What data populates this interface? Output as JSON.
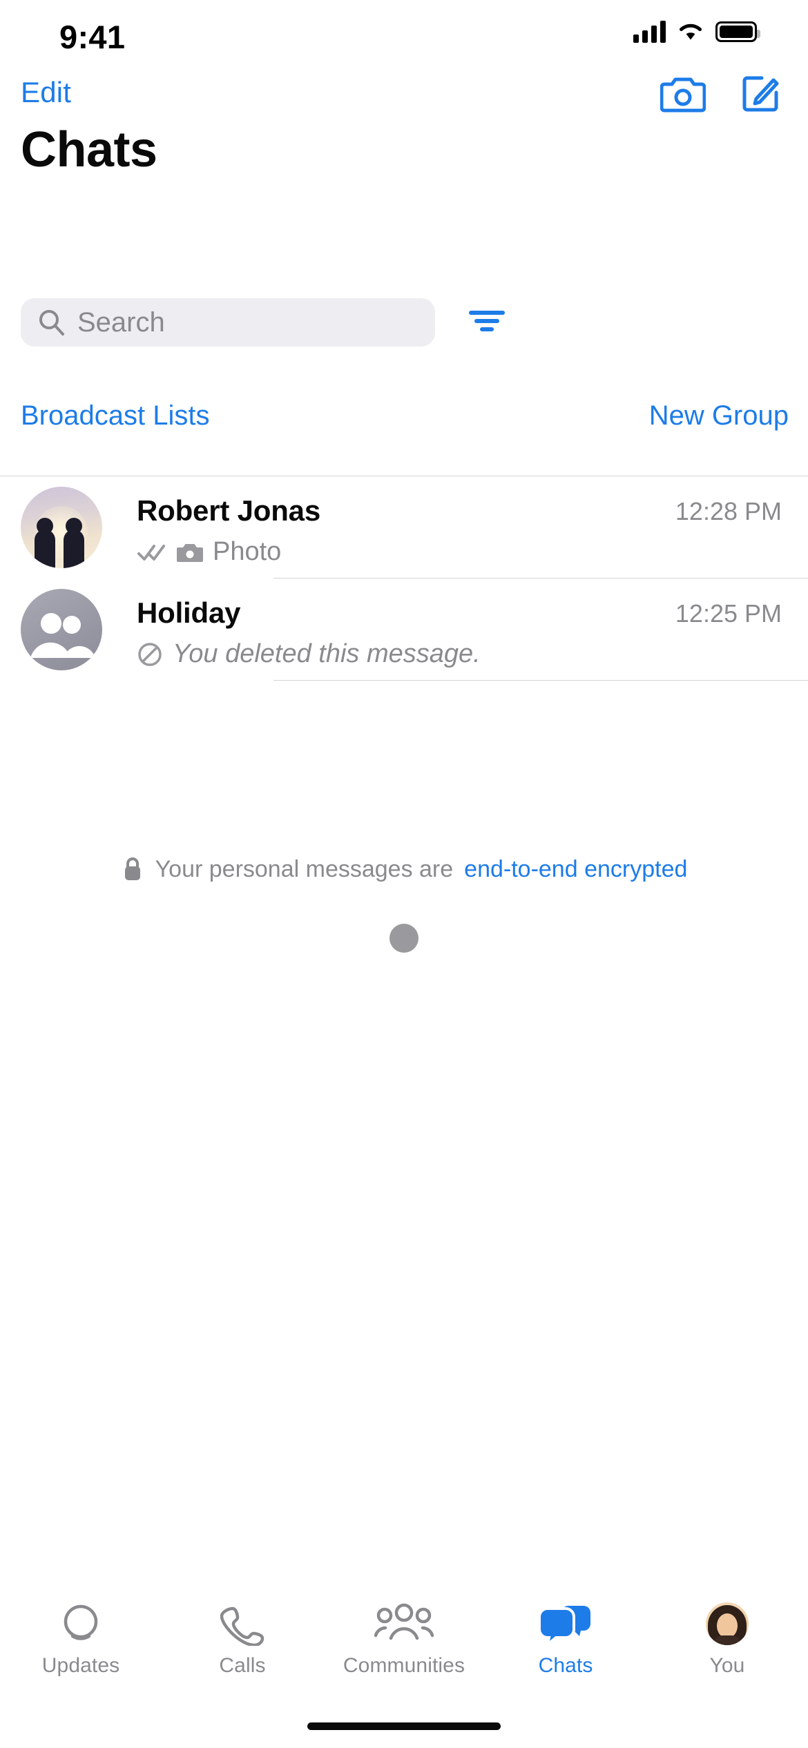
{
  "status_bar": {
    "time": "9:41",
    "signal_icon": "cellular-bars-icon",
    "wifi_icon": "wifi-icon",
    "battery_icon": "battery-full-icon"
  },
  "nav_bar": {
    "edit_label": "Edit",
    "camera_icon": "camera-icon",
    "compose_icon": "compose-new-chat-icon"
  },
  "header": {
    "title": "Chats"
  },
  "search": {
    "placeholder": "Search",
    "search_icon": "search-icon",
    "filter_icon": "filter-icon"
  },
  "quick_actions": {
    "broadcast_lists_label": "Broadcast Lists",
    "new_group_label": "New Group"
  },
  "chats": [
    {
      "name": "Robert Jonas",
      "time": "12:28 PM",
      "preview": "Photo",
      "avatar_kind": "photo-sunset-silhouettes",
      "status_icon": "double-check-icon",
      "attachment_icon": "camera-icon",
      "italic": false
    },
    {
      "name": "Holiday",
      "time": "12:25 PM",
      "preview": "You deleted this message.",
      "avatar_kind": "group-default-avatar",
      "status_icon": "deleted-message-icon",
      "attachment_icon": "",
      "italic": true
    }
  ],
  "encryption_notice": {
    "lock_icon": "lock-icon",
    "text": "Your personal messages are",
    "link": "end-to-end encrypted"
  },
  "loading": {
    "spinner": "loading-dot"
  },
  "tab_bar": {
    "items": [
      {
        "label": "Updates",
        "icon": "updates-status-icon",
        "active": false
      },
      {
        "label": "Calls",
        "icon": "phone-icon",
        "active": false
      },
      {
        "label": "Communities",
        "icon": "communities-icon",
        "active": false
      },
      {
        "label": "Chats",
        "icon": "chat-bubbles-icon",
        "active": true
      },
      {
        "label": "You",
        "icon": "profile-avatar-icon",
        "active": false
      }
    ]
  },
  "colors": {
    "accent": "#1d7ce8",
    "secondary_text": "#8a8a8e",
    "primary_text": "#0a0a0a",
    "search_field_bg": "#eeedf1",
    "separator": "#d4d4d8"
  }
}
